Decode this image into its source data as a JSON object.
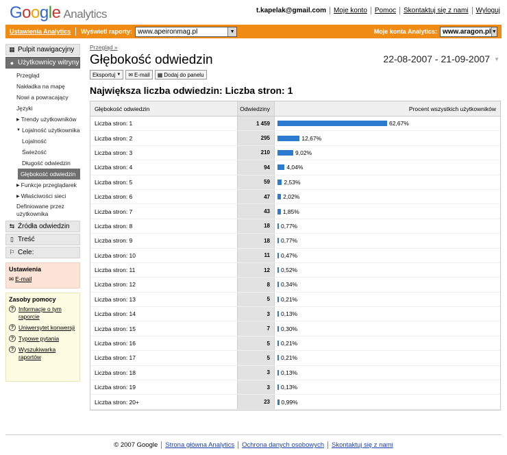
{
  "header": {
    "logo_google": "Google",
    "logo_product": "Analytics",
    "user_email": "t.kapelak@gmail.com",
    "links": [
      "Moje konto",
      "Pomoc",
      "Skontaktuj się z nami",
      "Wyloguj"
    ]
  },
  "orange_bar": {
    "settings_link": "Ustawienia Analytics",
    "view_reports_label": "Wyświetl raporty:",
    "view_reports_value": "www.apeironmag.pl",
    "accounts_label": "Moje konta Analytics:",
    "accounts_value": "www.aragon.pl"
  },
  "sidebar": {
    "dashboard": "Pulpit nawigacyjny",
    "visitors": "Użytkownicy witryny",
    "items": [
      {
        "label": "Przegląd",
        "level": 1
      },
      {
        "label": "Nakładka na mapę",
        "level": 1
      },
      {
        "label": "Nowi a powracający",
        "level": 1
      },
      {
        "label": "Języki",
        "level": 1
      },
      {
        "label": "Trendy użytkowników",
        "level": 1,
        "arrow": "▶"
      },
      {
        "label": "Lojalność użytkownika",
        "level": 1,
        "arrow": "▼"
      },
      {
        "label": "Lojalność",
        "level": 2
      },
      {
        "label": "Świeżość",
        "level": 2
      },
      {
        "label": "Długość odwiedzin",
        "level": 2
      },
      {
        "label": "Głębokość odwiedzin",
        "level": 2,
        "selected": true
      },
      {
        "label": "Funkcje przeglądarek",
        "level": 1,
        "arrow": "▶"
      },
      {
        "label": "Właściwości sieci",
        "level": 1,
        "arrow": "▶"
      },
      {
        "label": "Definiowane przez użytkownika",
        "level": 1,
        "wrap": true
      }
    ],
    "traffic_sources": "Źródła odwiedzin",
    "content": "Treść",
    "goals": "Cele:",
    "settings_title": "Ustawienia",
    "settings_email": "E-mail",
    "help_title": "Zasoby pomocy",
    "help_links": [
      "Informacje o tym raporcie",
      "Uniwersytet konwersji",
      "Typowe pytania",
      "Wyszukiwarka raportów"
    ]
  },
  "main": {
    "breadcrumb": "Przegląd »",
    "title": "Głębokość odwiedzin",
    "date_range": "22-08-2007 - 21-09-2007",
    "actions": {
      "export": "Eksportuj",
      "email": "E-mail",
      "add_dashboard": "Dodaj do panelu"
    },
    "subtitle": "Największa liczba odwiedzin: Liczba stron: 1",
    "table": {
      "headers": [
        "Głębokość odwiedzin",
        "Odwiedziny",
        "Procent wszystkich użytkowników"
      ],
      "rows": [
        {
          "label": "Liczba stron: 1",
          "visits": "1 459",
          "percent": "62,67%",
          "value": 62.67
        },
        {
          "label": "Liczba stron: 2",
          "visits": "295",
          "percent": "12,67%",
          "value": 12.67
        },
        {
          "label": "Liczba stron: 3",
          "visits": "210",
          "percent": "9,02%",
          "value": 9.02
        },
        {
          "label": "Liczba stron: 4",
          "visits": "94",
          "percent": "4,04%",
          "value": 4.04
        },
        {
          "label": "Liczba stron: 5",
          "visits": "59",
          "percent": "2,53%",
          "value": 2.53
        },
        {
          "label": "Liczba stron: 6",
          "visits": "47",
          "percent": "2,02%",
          "value": 2.02
        },
        {
          "label": "Liczba stron: 7",
          "visits": "43",
          "percent": "1,85%",
          "value": 1.85
        },
        {
          "label": "Liczba stron: 8",
          "visits": "18",
          "percent": "0,77%",
          "value": 0.77
        },
        {
          "label": "Liczba stron: 9",
          "visits": "18",
          "percent": "0,77%",
          "value": 0.77
        },
        {
          "label": "Liczba stron: 10",
          "visits": "11",
          "percent": "0,47%",
          "value": 0.47
        },
        {
          "label": "Liczba stron: 11",
          "visits": "12",
          "percent": "0,52%",
          "value": 0.52
        },
        {
          "label": "Liczba stron: 12",
          "visits": "8",
          "percent": "0,34%",
          "value": 0.34
        },
        {
          "label": "Liczba stron: 13",
          "visits": "5",
          "percent": "0,21%",
          "value": 0.21
        },
        {
          "label": "Liczba stron: 14",
          "visits": "3",
          "percent": "0,13%",
          "value": 0.13
        },
        {
          "label": "Liczba stron: 15",
          "visits": "7",
          "percent": "0,30%",
          "value": 0.3
        },
        {
          "label": "Liczba stron: 16",
          "visits": "5",
          "percent": "0,21%",
          "value": 0.21
        },
        {
          "label": "Liczba stron: 17",
          "visits": "5",
          "percent": "0,21%",
          "value": 0.21
        },
        {
          "label": "Liczba stron: 18",
          "visits": "3",
          "percent": "0,13%",
          "value": 0.13
        },
        {
          "label": "Liczba stron: 19",
          "visits": "3",
          "percent": "0,13%",
          "value": 0.13
        },
        {
          "label": "Liczba stron: 20+",
          "visits": "23",
          "percent": "0,99%",
          "value": 0.99
        }
      ]
    }
  },
  "footer": {
    "copyright": "© 2007 Google",
    "links": [
      "Strona główna Analytics",
      "Ochrona danych osobowych",
      "Skontaktuj się z nami"
    ]
  },
  "colors": {
    "accent_orange": "#f08c16",
    "bar_blue": "#2b7bd0"
  }
}
